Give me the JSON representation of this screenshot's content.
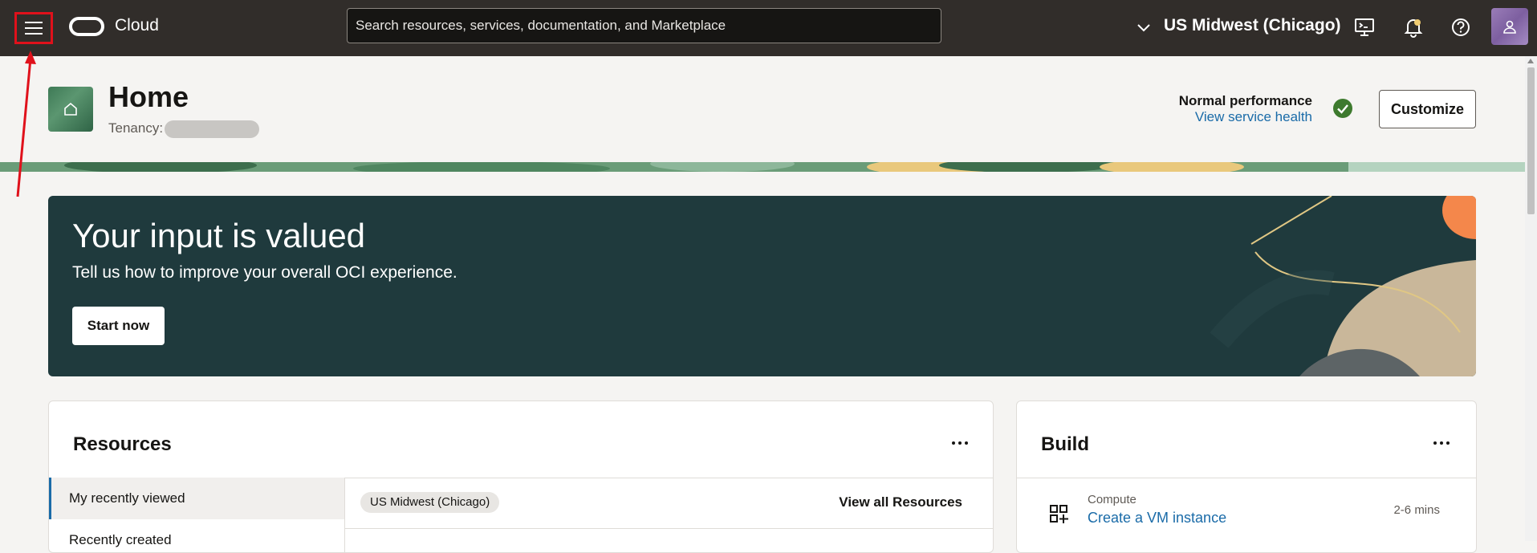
{
  "topbar": {
    "brand_label": "Cloud",
    "search_placeholder": "Search resources, services, documentation, and Marketplace",
    "region_label": "US Midwest (Chicago)",
    "icons": [
      "menu-icon",
      "oracle-logo-icon",
      "chevron-down-icon",
      "cloud-shell-icon",
      "bell-icon",
      "help-icon",
      "user-icon"
    ],
    "highlight_color": "#e0111b"
  },
  "header": {
    "title": "Home",
    "tenancy_label": "Tenancy:",
    "performance_status": "Normal performance",
    "service_health_link": "View service health",
    "customize_label": "Customize"
  },
  "banner": {
    "title": "Your input is valued",
    "subtitle": "Tell us how to improve your overall OCI experience.",
    "button_label": "Start now"
  },
  "resources": {
    "title": "Resources",
    "tabs": [
      {
        "label": "My recently viewed",
        "active": true
      },
      {
        "label": "Recently created",
        "active": false
      }
    ],
    "region_chip": "US Midwest (Chicago)",
    "view_all_label": "View all Resources"
  },
  "build": {
    "title": "Build",
    "items": [
      {
        "category": "Compute",
        "link": "Create a VM instance",
        "duration": "2-6 mins"
      }
    ]
  },
  "colors": {
    "topbar_bg": "#312d2a",
    "banner_bg": "#1f3a3d",
    "link": "#1a6ba8",
    "success": "#3d7a2e"
  }
}
